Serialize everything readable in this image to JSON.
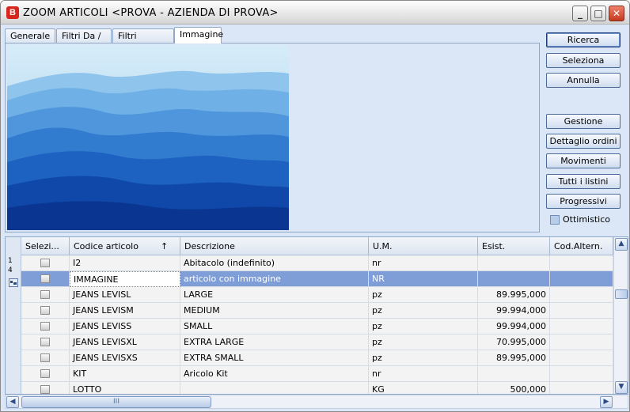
{
  "window": {
    "title": "ZOOM ARTICOLI <PROVA - AZIENDA DI PROVA>",
    "app_icon_letter": "B",
    "controls": {
      "minimize": "_",
      "maximize": "□",
      "close": "✕"
    }
  },
  "tabs": [
    {
      "label": "Generale"
    },
    {
      "label": "Filtri Da / a"
    },
    {
      "label": "Filtri particolari"
    },
    {
      "label": "Immagine",
      "active": true
    }
  ],
  "side_buttons": {
    "ricerca": "Ricerca",
    "seleziona": "Seleziona",
    "annulla": "Annulla",
    "gestione": "Gestione",
    "dettaglio_ordini": "Dettaglio ordini",
    "movimenti": "Movimenti",
    "tutti_listini": "Tutti i listini",
    "progressivi": "Progressivi"
  },
  "ottimistico": {
    "label": "Ottimistico",
    "checked": false
  },
  "grid": {
    "row_header": {
      "line1": "1",
      "line2": "4",
      "icon": "record-icon"
    },
    "columns": {
      "seleziona": "Selezi...",
      "codice": "Codice articolo",
      "descrizione": "Descrizione",
      "um": "U.M.",
      "esist": "Esist.",
      "cod_altern": "Cod.Altern."
    },
    "sort_indicator": "↑",
    "rows": [
      {
        "codice": "I2",
        "descrizione": "Abitacolo (indefinito)",
        "um": "nr",
        "esist": ""
      },
      {
        "codice": "IMMAGINE",
        "descrizione": "articolo con immagine",
        "um": "NR",
        "esist": "",
        "selected": true
      },
      {
        "codice": "JEANS LEVISL",
        "descrizione": "LARGE",
        "um": "pz",
        "esist": "89.995,000"
      },
      {
        "codice": "JEANS LEVISM",
        "descrizione": "MEDIUM",
        "um": "pz",
        "esist": "99.994,000"
      },
      {
        "codice": "JEANS LEVISS",
        "descrizione": "SMALL",
        "um": "pz",
        "esist": "99.994,000"
      },
      {
        "codice": "JEANS LEVISXL",
        "descrizione": "EXTRA LARGE",
        "um": "pz",
        "esist": "70.995,000"
      },
      {
        "codice": "JEANS LEVISXS",
        "descrizione": "EXTRA SMALL",
        "um": "pz",
        "esist": "89.995,000"
      },
      {
        "codice": "KIT",
        "descrizione": "Aricolo Kit",
        "um": "nr",
        "esist": ""
      },
      {
        "codice": "LOTTO",
        "descrizione": "",
        "um": "KG",
        "esist": "500,000"
      }
    ]
  },
  "scroll": {
    "up": "▲",
    "down": "▼",
    "left": "◀",
    "right": "▶",
    "grip": "III"
  },
  "colors": {
    "accent": "#7f9ed7",
    "panel": "#dbe7f7",
    "mountain_sky": "#bfe0f5",
    "mountain_dark": "#0c3fae"
  }
}
